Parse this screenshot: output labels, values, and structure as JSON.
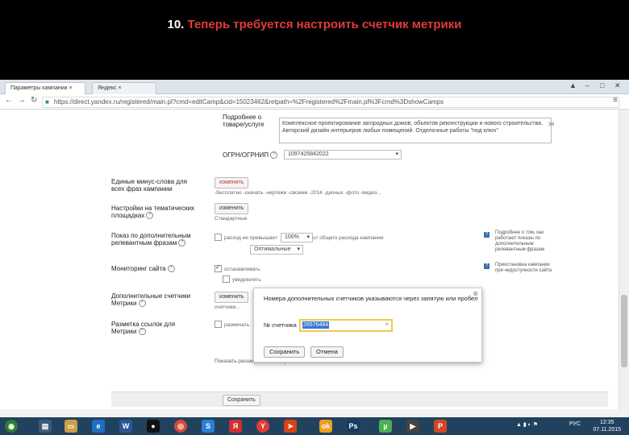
{
  "slide": {
    "number": "10.",
    "title": "Теперь требуется настроить счетчик метрики"
  },
  "browser": {
    "tabs": [
      {
        "label": "Параметры кампании"
      },
      {
        "label": "Яндекс"
      }
    ],
    "url": "https://direct.yandex.ru/registered/main.pl?cmd=editCamp&cid=15023462&retpath=%2Fregistered%2Fmain.pl%3Fcmd%3DshowCamps"
  },
  "form": {
    "desc_label": "Подробнее о товаре/услуге",
    "desc_value": "Комплексное проектирование загородных домов, объектов реконструкции и нового строительства. Авторский дизайн интерьеров любых помещений. Отделочные работы \"под ключ\"",
    "desc_counter": "34",
    "ogrn_label": "ОГРН/ОГРНИП",
    "ogrn_value": "1097425842022",
    "neg_words_label": "Единые минус-слова для всех фраз кампании",
    "neg_words_button": "изменить",
    "neg_words_value": "-бесплатно -скачать -чертежи -своими -2014 -дачных -фото -видео...",
    "thematic_label": "Настройки на тематических площадках",
    "thematic_button": "изменить",
    "thematic_value": "Стандартные",
    "extra_label": "Показ по дополнительным релевантным фразам",
    "extra_option": "расход не превышает",
    "extra_percent": "100%",
    "extra_suffix": "от общего расхода кампании",
    "extra_select": "Оптимальные",
    "monitor_label": "Мониторинг сайта",
    "monitor_option": "останавливать",
    "monitor_notify": "уведомлять",
    "metrika_label": "Дополнительные счетчики Метрики",
    "metrika_button": "изменить",
    "metrika_value": "счетчики...",
    "tags_label": "Разметка ссылок для Метрики",
    "tags_option": "размечать",
    "more_settings": "Показать расширенные настройки",
    "save_button": "Сохранить"
  },
  "hints": {
    "extra": "Подробнее о том, как работают показы по дополнительным релевантным фразам",
    "monitor": "Приостановка кампании при недоступности сайта"
  },
  "popup": {
    "text": "Номера дополнительных счетчиков указываются через запятую или пробел",
    "field_label": "№ счетчика",
    "field_value": "26576484",
    "save": "Сохранить",
    "cancel": "Отмена"
  },
  "taskbar": {
    "lang": "РУС",
    "time": "12:35",
    "date": "07.11.2015"
  },
  "colors": {
    "title_accent": "#e03b3b",
    "taskbar": "#21425f",
    "selection": "#3875d7"
  }
}
